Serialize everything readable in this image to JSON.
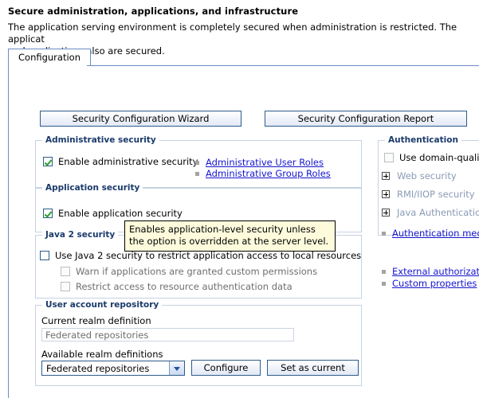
{
  "page": {
    "title": "Secure administration, applications, and infrastructure",
    "description": "The application serving environment is completely secured when administration is restricted. The applicat\nand applications also are secured."
  },
  "tabs": [
    {
      "label": "Configuration",
      "selected": true
    }
  ],
  "toolbar": {
    "wizard_label": "Security Configuration Wizard",
    "report_label": "Security Configuration Report"
  },
  "administrative_security": {
    "legend": "Administrative security",
    "enable_label": "Enable administrative security",
    "enable_checked": true,
    "links": [
      "Administrative User Roles ",
      "Administrative Group Roles "
    ]
  },
  "application_security": {
    "legend": "Application security",
    "enable_label": "Enable application security",
    "enable_checked": true
  },
  "tooltip": {
    "text": "Enables application-level security unless the option is overridden at the server level."
  },
  "java2_security": {
    "legend": "Java 2 security",
    "use_label": "Use Java 2 security to restrict application access to local resources",
    "use_checked": false,
    "warn_label": "Warn if applications are granted custom permissions",
    "warn_checked": false,
    "warn_disabled": true,
    "restrict_label": "Restrict access to resource authentication data",
    "restrict_checked": false,
    "restrict_disabled": true
  },
  "user_account_repository": {
    "legend": "User account repository",
    "current_label": "Current realm definition",
    "current_value": "Federated repositories",
    "available_label": "Available realm definitions",
    "available_value": "Federated repositories",
    "configure_label": "Configure",
    "set_as_current_label": "Set as current"
  },
  "authentication": {
    "legend": "Authentication",
    "domain_qualified_label": "Use domain-quali",
    "domain_qualified_checked": false,
    "tree_items": [
      "Web security",
      "RMI/IIOP security",
      "Java Authentication"
    ],
    "links": [
      "Authentication mecha"
    ]
  },
  "side_links": [
    "External authorization",
    "Custom properties"
  ],
  "colors": {
    "accent_border": "#6b8cc4",
    "legend_text": "#1a3a6b",
    "link": "#1515cf",
    "check_green": "#2aa02a",
    "tooltip_bg": "#fdfbdc",
    "disabled_text": "#8a9bb5"
  }
}
